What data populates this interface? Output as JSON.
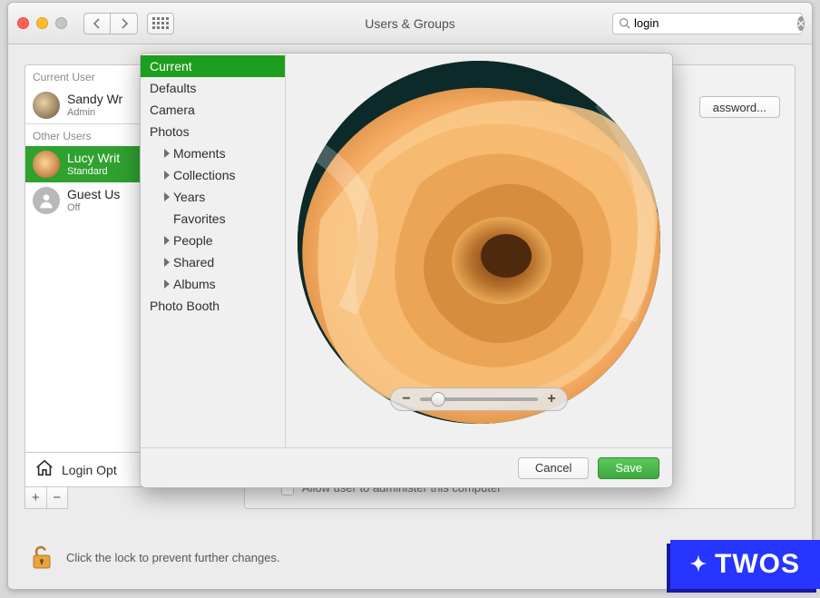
{
  "titlebar": {
    "title": "Users & Groups",
    "search_value": "login",
    "search_placeholder": "Search"
  },
  "sidebar": {
    "current_label": "Current User",
    "other_label": "Other Users",
    "current_user": {
      "name": "Sandy Wr",
      "role": "Admin"
    },
    "other_users": [
      {
        "name": "Lucy Writ",
        "role": "Standard"
      },
      {
        "name": "Guest Us",
        "role": "Off"
      }
    ],
    "login_options": "Login Opt"
  },
  "right": {
    "change_password": "assword...",
    "admin_text": "Allow user to administer this computer"
  },
  "lock_text": "Click the lock to prevent further changes.",
  "popover": {
    "items": {
      "current": "Current",
      "defaults": "Defaults",
      "camera": "Camera",
      "photos": "Photos",
      "moments": "Moments",
      "collections": "Collections",
      "years": "Years",
      "favorites": "Favorites",
      "people": "People",
      "shared": "Shared",
      "albums": "Albums",
      "photobooth": "Photo Booth"
    },
    "cancel": "Cancel",
    "save": "Save"
  },
  "watermark": "TWOS"
}
